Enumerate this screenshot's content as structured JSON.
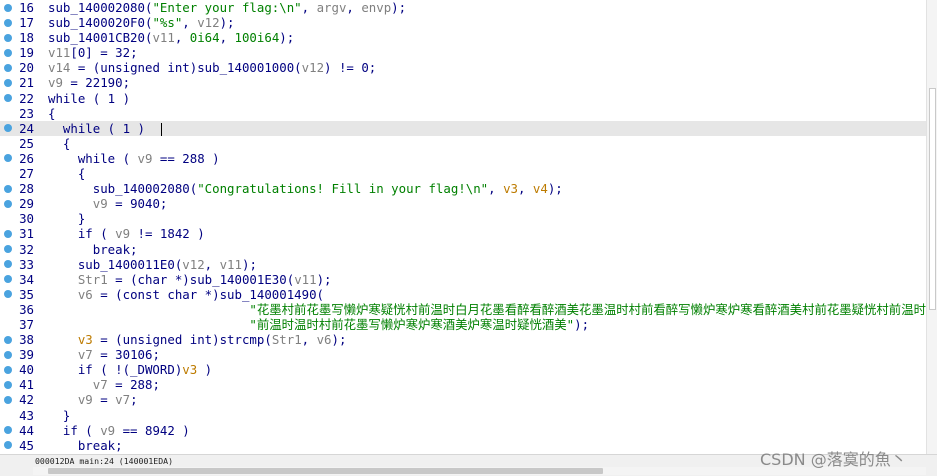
{
  "editor": {
    "current_line": 24,
    "lines": [
      {
        "num": "16",
        "dot": true,
        "tokens": [
          [
            "plain",
            "sub_140002080("
          ],
          [
            "str",
            "\"Enter your flag:\\n\""
          ],
          [
            "plain",
            ", "
          ],
          [
            "var",
            "argv"
          ],
          [
            "plain",
            ", "
          ],
          [
            "var",
            "envp"
          ],
          [
            "plain",
            ");"
          ]
        ]
      },
      {
        "num": "17",
        "dot": true,
        "tokens": [
          [
            "plain",
            "sub_1400020F0("
          ],
          [
            "str",
            "\"%s\""
          ],
          [
            "plain",
            ", "
          ],
          [
            "var",
            "v12"
          ],
          [
            "plain",
            ");"
          ]
        ]
      },
      {
        "num": "18",
        "dot": true,
        "tokens": [
          [
            "plain",
            "sub_14001CB20("
          ],
          [
            "var",
            "v11"
          ],
          [
            "plain",
            ", "
          ],
          [
            "num",
            "0i64"
          ],
          [
            "plain",
            ", "
          ],
          [
            "num",
            "100i64"
          ],
          [
            "plain",
            ");"
          ]
        ]
      },
      {
        "num": "19",
        "dot": true,
        "tokens": [
          [
            "var",
            "v11"
          ],
          [
            "plain",
            "[0] = 32;"
          ]
        ]
      },
      {
        "num": "20",
        "dot": true,
        "tokens": [
          [
            "var",
            "v14"
          ],
          [
            "plain",
            " = (unsigned int)sub_140001000("
          ],
          [
            "var",
            "v12"
          ],
          [
            "plain",
            ") != 0;"
          ]
        ]
      },
      {
        "num": "21",
        "dot": true,
        "tokens": [
          [
            "var",
            "v9"
          ],
          [
            "plain",
            " = 22190;"
          ]
        ]
      },
      {
        "num": "22",
        "dot": true,
        "tokens": [
          [
            "plain",
            "while ( 1 )"
          ]
        ]
      },
      {
        "num": "23",
        "dot": false,
        "tokens": [
          [
            "plain",
            "{"
          ]
        ]
      },
      {
        "num": "24",
        "dot": true,
        "tokens": [
          [
            "plain",
            "  while ( 1 )  "
          ]
        ]
      },
      {
        "num": "25",
        "dot": false,
        "tokens": [
          [
            "plain",
            "  {"
          ]
        ]
      },
      {
        "num": "26",
        "dot": true,
        "tokens": [
          [
            "plain",
            "    while ( "
          ],
          [
            "var",
            "v9"
          ],
          [
            "plain",
            " == 288 )"
          ]
        ]
      },
      {
        "num": "27",
        "dot": false,
        "tokens": [
          [
            "plain",
            "    {"
          ]
        ]
      },
      {
        "num": "28",
        "dot": true,
        "tokens": [
          [
            "plain",
            "      sub_140002080("
          ],
          [
            "str",
            "\"Congratulations! Fill in your flag!\\n\""
          ],
          [
            "plain",
            ", "
          ],
          [
            "arg",
            "v3"
          ],
          [
            "plain",
            ", "
          ],
          [
            "arg",
            "v4"
          ],
          [
            "plain",
            ");"
          ]
        ]
      },
      {
        "num": "29",
        "dot": true,
        "tokens": [
          [
            "plain",
            "      "
          ],
          [
            "var",
            "v9"
          ],
          [
            "plain",
            " = 9040;"
          ]
        ]
      },
      {
        "num": "30",
        "dot": false,
        "tokens": [
          [
            "plain",
            "    }"
          ]
        ]
      },
      {
        "num": "31",
        "dot": true,
        "tokens": [
          [
            "plain",
            "    if ( "
          ],
          [
            "var",
            "v9"
          ],
          [
            "plain",
            " != 1842 )"
          ]
        ]
      },
      {
        "num": "32",
        "dot": true,
        "tokens": [
          [
            "plain",
            "      break;"
          ]
        ]
      },
      {
        "num": "33",
        "dot": true,
        "tokens": [
          [
            "plain",
            "    sub_1400011E0("
          ],
          [
            "var",
            "v12"
          ],
          [
            "plain",
            ", "
          ],
          [
            "var",
            "v11"
          ],
          [
            "plain",
            ");"
          ]
        ]
      },
      {
        "num": "34",
        "dot": true,
        "tokens": [
          [
            "plain",
            "    "
          ],
          [
            "var",
            "Str1"
          ],
          [
            "plain",
            " = (char *)sub_140001E30("
          ],
          [
            "var",
            "v11"
          ],
          [
            "plain",
            ");"
          ]
        ]
      },
      {
        "num": "35",
        "dot": true,
        "tokens": [
          [
            "plain",
            "    "
          ],
          [
            "var",
            "v6"
          ],
          [
            "plain",
            " = (const char *)sub_140001490("
          ]
        ]
      },
      {
        "num": "36",
        "dot": false,
        "tokens": [
          [
            "plain",
            "                           "
          ],
          [
            "str",
            "\"花墨村前花墨写懒炉寒疑恍村前温时白月花墨看醉看醉酒美花墨温时村前看醉写懒炉寒炉寒看醉酒美村前花墨疑恍村前温时白"
          ]
        ]
      },
      {
        "num": "37",
        "dot": false,
        "tokens": [
          [
            "plain",
            "                           "
          ],
          [
            "str",
            "\"前温时温时村前花墨写懒炉寒炉寒酒美炉寒温时疑恍酒美\""
          ],
          [
            "plain",
            ");"
          ]
        ]
      },
      {
        "num": "38",
        "dot": true,
        "tokens": [
          [
            "plain",
            "    "
          ],
          [
            "arg",
            "v3"
          ],
          [
            "plain",
            " = (unsigned int)strcmp("
          ],
          [
            "var",
            "Str1"
          ],
          [
            "plain",
            ", "
          ],
          [
            "var",
            "v6"
          ],
          [
            "plain",
            ");"
          ]
        ]
      },
      {
        "num": "39",
        "dot": true,
        "tokens": [
          [
            "plain",
            "    "
          ],
          [
            "var",
            "v7"
          ],
          [
            "plain",
            " = 30106;"
          ]
        ]
      },
      {
        "num": "40",
        "dot": true,
        "tokens": [
          [
            "plain",
            "    if ( !(_DWORD)"
          ],
          [
            "arg",
            "v3"
          ],
          [
            "plain",
            " )"
          ]
        ]
      },
      {
        "num": "41",
        "dot": true,
        "tokens": [
          [
            "plain",
            "      "
          ],
          [
            "var",
            "v7"
          ],
          [
            "plain",
            " = 288;"
          ]
        ]
      },
      {
        "num": "42",
        "dot": true,
        "tokens": [
          [
            "plain",
            "    "
          ],
          [
            "var",
            "v9"
          ],
          [
            "plain",
            " = "
          ],
          [
            "var",
            "v7"
          ],
          [
            "plain",
            ";"
          ]
        ]
      },
      {
        "num": "43",
        "dot": false,
        "tokens": [
          [
            "plain",
            "  }"
          ]
        ]
      },
      {
        "num": "44",
        "dot": true,
        "tokens": [
          [
            "plain",
            "  if ( "
          ],
          [
            "var",
            "v9"
          ],
          [
            "plain",
            " == 8942 )"
          ]
        ]
      },
      {
        "num": "45",
        "dot": true,
        "tokens": [
          [
            "plain",
            "    break;"
          ]
        ]
      }
    ]
  },
  "status_bar": {
    "text": "000012DA main:24 (140001EDA)"
  },
  "watermark": "CSDN @落寞的魚丶",
  "colors": {
    "code": "#000080",
    "string": "#008000",
    "variable": "#808080",
    "argument": "#bd7b00",
    "breakpoint_dot": "#4aa3df",
    "current_line_bg": "#e6e6e6"
  }
}
